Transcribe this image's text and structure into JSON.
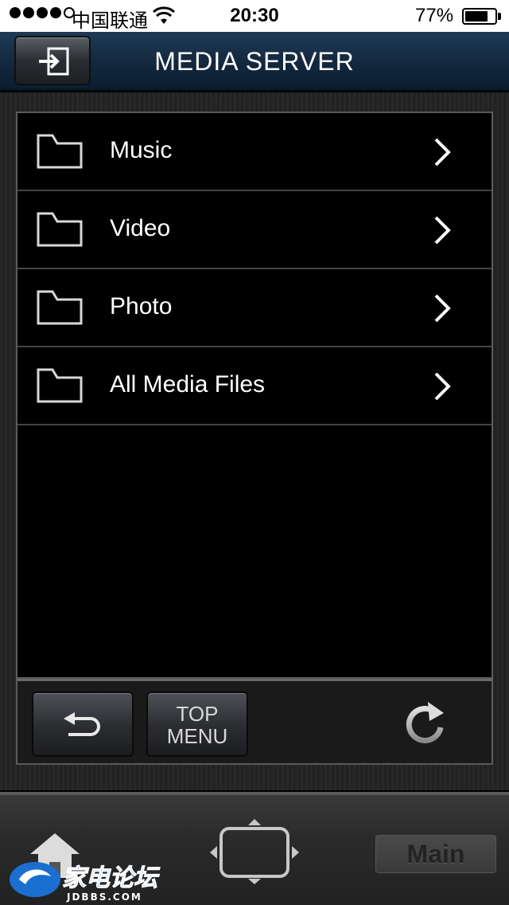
{
  "status_bar": {
    "carrier": "中国联通",
    "time": "20:30",
    "battery": "77%",
    "battery_level": 0.77,
    "signal_bars": 4,
    "signal_total": 5
  },
  "nav": {
    "title": "MEDIA SERVER",
    "exit_icon": "input-exit-icon"
  },
  "list": {
    "items": [
      {
        "label": "Music",
        "icon": "folder-icon"
      },
      {
        "label": "Video",
        "icon": "folder-icon"
      },
      {
        "label": "Photo",
        "icon": "folder-icon"
      },
      {
        "label": "All Media Files",
        "icon": "folder-icon"
      }
    ]
  },
  "toolbar": {
    "back_icon": "return-arrow-icon",
    "top_menu_line1": "TOP",
    "top_menu_line2": "MENU",
    "refresh_icon": "refresh-icon"
  },
  "tab_bar": {
    "home_icon": "home-icon",
    "dpad_icon": "dpad-icon",
    "main_label": "Main"
  },
  "watermark": {
    "text": "家电论坛",
    "subtext": "JDBBS.COM"
  },
  "colors": {
    "nav_bg": "#12283e",
    "panel_border": "#5a5a5a",
    "text": "#ffffff"
  }
}
